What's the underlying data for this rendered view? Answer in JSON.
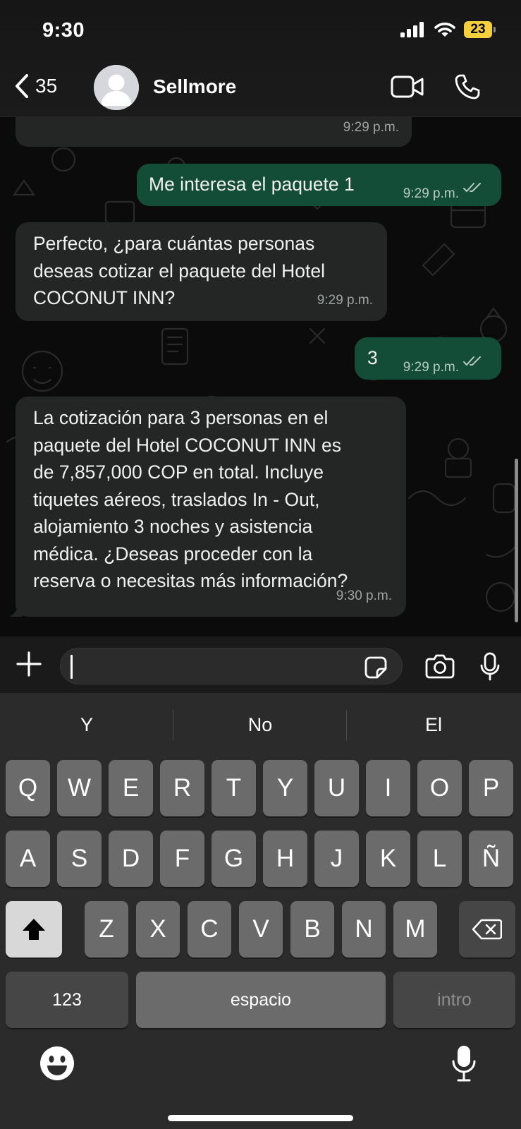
{
  "status_bar": {
    "time": "9:30",
    "battery": "23"
  },
  "header": {
    "back_count": "35",
    "contact_name": "Sellmore",
    "icons": [
      "back-chevron-icon",
      "avatar",
      "video-camera-icon",
      "phone-icon"
    ]
  },
  "chat": {
    "messages": [
      {
        "direction": "incoming",
        "text": "",
        "time": "9:29 p.m."
      },
      {
        "direction": "outgoing",
        "text": "Me interesa el paquete 1",
        "time": "9:29 p.m.",
        "status": "read"
      },
      {
        "direction": "incoming",
        "text": "Perfecto, ¿para cuántas personas\ndeseas cotizar el paquete del Hotel\nCOCONUT INN?",
        "time": "9:29 p.m."
      },
      {
        "direction": "outgoing",
        "text": "3",
        "time": "9:29 p.m.",
        "status": "read"
      },
      {
        "direction": "incoming",
        "text": "La cotización para 3 personas en el\npaquete del Hotel COCONUT INN es\nde 7,857,000 COP en total. Incluye\ntiquetes aéreos, traslados In - Out,\nalojamiento 3 noches y asistencia\nmédica. ¿Deseas proceder con la\nreserva o necesitas más información?",
        "time": "9:30 p.m."
      }
    ]
  },
  "composer": {
    "value": "",
    "icons": [
      "plus-icon",
      "sticker-icon",
      "camera-icon",
      "microphone-icon"
    ]
  },
  "keyboard": {
    "suggestions": [
      "Y",
      "No",
      "El"
    ],
    "row1": [
      "Q",
      "W",
      "E",
      "R",
      "T",
      "Y",
      "U",
      "I",
      "O",
      "P"
    ],
    "row2": [
      "A",
      "S",
      "D",
      "F",
      "G",
      "H",
      "J",
      "K",
      "L",
      "Ñ"
    ],
    "row3": [
      "Z",
      "X",
      "C",
      "V",
      "B",
      "N",
      "M"
    ],
    "numbers_key": "123",
    "space_key": "espacio",
    "return_key": "intro"
  },
  "colors": {
    "incoming_bubble": "#242626",
    "outgoing_bubble": "#144d37",
    "read_ticks": "#b5cbc1",
    "battery": "#f5cf3c"
  }
}
